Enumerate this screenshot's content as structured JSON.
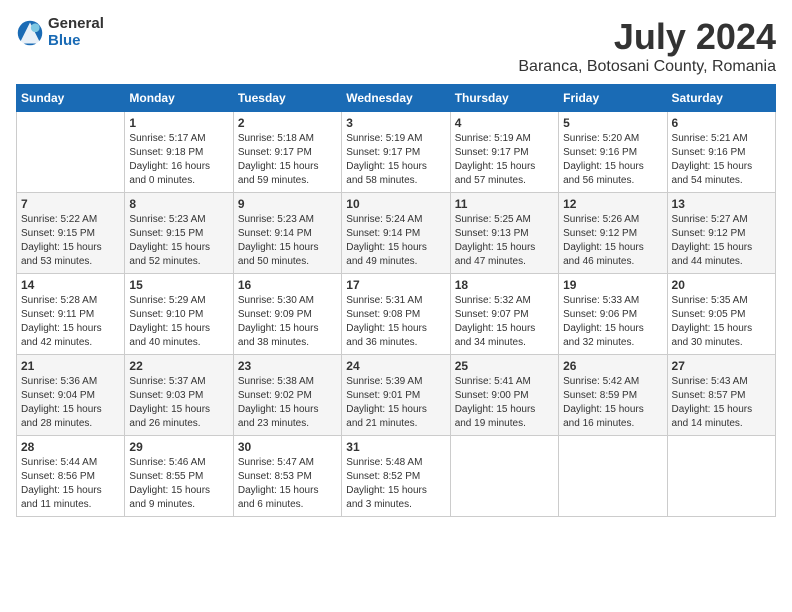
{
  "logo": {
    "general": "General",
    "blue": "Blue"
  },
  "title": {
    "month": "July 2024",
    "location": "Baranca, Botosani County, Romania"
  },
  "headers": [
    "Sunday",
    "Monday",
    "Tuesday",
    "Wednesday",
    "Thursday",
    "Friday",
    "Saturday"
  ],
  "weeks": [
    [
      {
        "day": "",
        "info": ""
      },
      {
        "day": "1",
        "info": "Sunrise: 5:17 AM\nSunset: 9:18 PM\nDaylight: 16 hours\nand 0 minutes."
      },
      {
        "day": "2",
        "info": "Sunrise: 5:18 AM\nSunset: 9:17 PM\nDaylight: 15 hours\nand 59 minutes."
      },
      {
        "day": "3",
        "info": "Sunrise: 5:19 AM\nSunset: 9:17 PM\nDaylight: 15 hours\nand 58 minutes."
      },
      {
        "day": "4",
        "info": "Sunrise: 5:19 AM\nSunset: 9:17 PM\nDaylight: 15 hours\nand 57 minutes."
      },
      {
        "day": "5",
        "info": "Sunrise: 5:20 AM\nSunset: 9:16 PM\nDaylight: 15 hours\nand 56 minutes."
      },
      {
        "day": "6",
        "info": "Sunrise: 5:21 AM\nSunset: 9:16 PM\nDaylight: 15 hours\nand 54 minutes."
      }
    ],
    [
      {
        "day": "7",
        "info": "Sunrise: 5:22 AM\nSunset: 9:15 PM\nDaylight: 15 hours\nand 53 minutes."
      },
      {
        "day": "8",
        "info": "Sunrise: 5:23 AM\nSunset: 9:15 PM\nDaylight: 15 hours\nand 52 minutes."
      },
      {
        "day": "9",
        "info": "Sunrise: 5:23 AM\nSunset: 9:14 PM\nDaylight: 15 hours\nand 50 minutes."
      },
      {
        "day": "10",
        "info": "Sunrise: 5:24 AM\nSunset: 9:14 PM\nDaylight: 15 hours\nand 49 minutes."
      },
      {
        "day": "11",
        "info": "Sunrise: 5:25 AM\nSunset: 9:13 PM\nDaylight: 15 hours\nand 47 minutes."
      },
      {
        "day": "12",
        "info": "Sunrise: 5:26 AM\nSunset: 9:12 PM\nDaylight: 15 hours\nand 46 minutes."
      },
      {
        "day": "13",
        "info": "Sunrise: 5:27 AM\nSunset: 9:12 PM\nDaylight: 15 hours\nand 44 minutes."
      }
    ],
    [
      {
        "day": "14",
        "info": "Sunrise: 5:28 AM\nSunset: 9:11 PM\nDaylight: 15 hours\nand 42 minutes."
      },
      {
        "day": "15",
        "info": "Sunrise: 5:29 AM\nSunset: 9:10 PM\nDaylight: 15 hours\nand 40 minutes."
      },
      {
        "day": "16",
        "info": "Sunrise: 5:30 AM\nSunset: 9:09 PM\nDaylight: 15 hours\nand 38 minutes."
      },
      {
        "day": "17",
        "info": "Sunrise: 5:31 AM\nSunset: 9:08 PM\nDaylight: 15 hours\nand 36 minutes."
      },
      {
        "day": "18",
        "info": "Sunrise: 5:32 AM\nSunset: 9:07 PM\nDaylight: 15 hours\nand 34 minutes."
      },
      {
        "day": "19",
        "info": "Sunrise: 5:33 AM\nSunset: 9:06 PM\nDaylight: 15 hours\nand 32 minutes."
      },
      {
        "day": "20",
        "info": "Sunrise: 5:35 AM\nSunset: 9:05 PM\nDaylight: 15 hours\nand 30 minutes."
      }
    ],
    [
      {
        "day": "21",
        "info": "Sunrise: 5:36 AM\nSunset: 9:04 PM\nDaylight: 15 hours\nand 28 minutes."
      },
      {
        "day": "22",
        "info": "Sunrise: 5:37 AM\nSunset: 9:03 PM\nDaylight: 15 hours\nand 26 minutes."
      },
      {
        "day": "23",
        "info": "Sunrise: 5:38 AM\nSunset: 9:02 PM\nDaylight: 15 hours\nand 23 minutes."
      },
      {
        "day": "24",
        "info": "Sunrise: 5:39 AM\nSunset: 9:01 PM\nDaylight: 15 hours\nand 21 minutes."
      },
      {
        "day": "25",
        "info": "Sunrise: 5:41 AM\nSunset: 9:00 PM\nDaylight: 15 hours\nand 19 minutes."
      },
      {
        "day": "26",
        "info": "Sunrise: 5:42 AM\nSunset: 8:59 PM\nDaylight: 15 hours\nand 16 minutes."
      },
      {
        "day": "27",
        "info": "Sunrise: 5:43 AM\nSunset: 8:57 PM\nDaylight: 15 hours\nand 14 minutes."
      }
    ],
    [
      {
        "day": "28",
        "info": "Sunrise: 5:44 AM\nSunset: 8:56 PM\nDaylight: 15 hours\nand 11 minutes."
      },
      {
        "day": "29",
        "info": "Sunrise: 5:46 AM\nSunset: 8:55 PM\nDaylight: 15 hours\nand 9 minutes."
      },
      {
        "day": "30",
        "info": "Sunrise: 5:47 AM\nSunset: 8:53 PM\nDaylight: 15 hours\nand 6 minutes."
      },
      {
        "day": "31",
        "info": "Sunrise: 5:48 AM\nSunset: 8:52 PM\nDaylight: 15 hours\nand 3 minutes."
      },
      {
        "day": "",
        "info": ""
      },
      {
        "day": "",
        "info": ""
      },
      {
        "day": "",
        "info": ""
      }
    ]
  ]
}
